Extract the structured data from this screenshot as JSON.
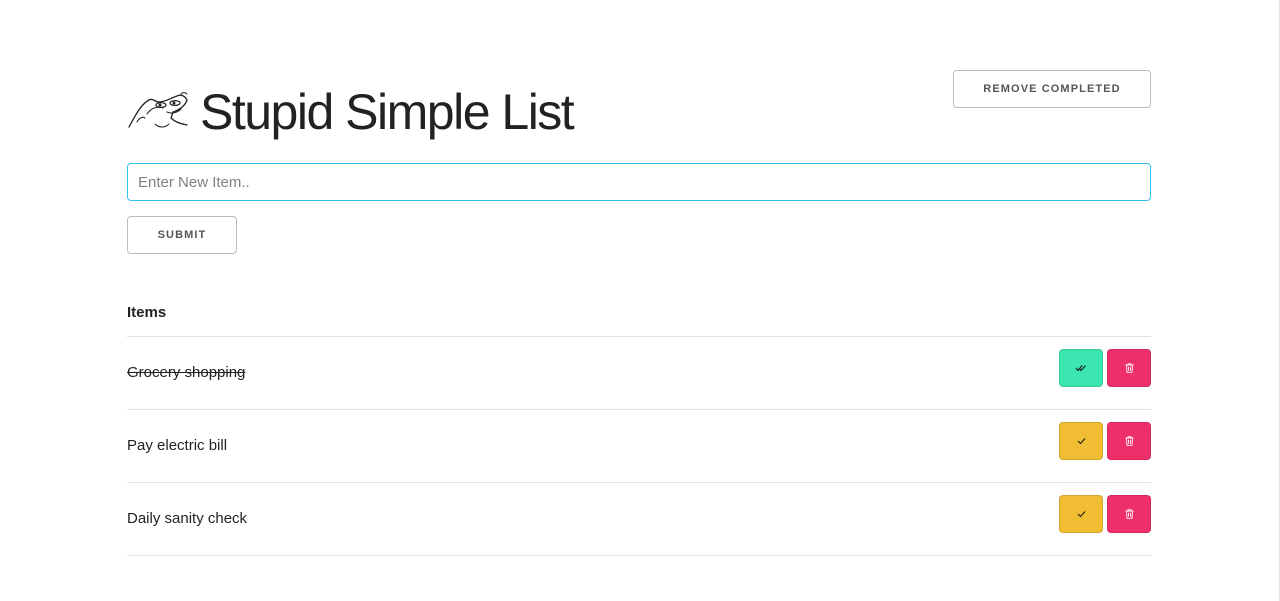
{
  "app": {
    "title": "Stupid Simple List",
    "logo_icon": "frog-face-icon"
  },
  "toolbar": {
    "remove_completed_label": "Remove Completed"
  },
  "form": {
    "placeholder": "Enter New Item..",
    "value": "",
    "submit_label": "Submit"
  },
  "list": {
    "header": "Items",
    "items": [
      {
        "label": "Grocery shopping",
        "completed": true
      },
      {
        "label": "Pay electric bill",
        "completed": false
      },
      {
        "label": "Daily sanity check",
        "completed": false
      }
    ]
  },
  "colors": {
    "accent_input_border": "#33c3f0",
    "complete_done": "#3de6b0",
    "complete_todo": "#f0bd33",
    "delete": "#ef2f6a"
  },
  "icons": {
    "done": "double-check-icon",
    "todo": "check-icon",
    "delete": "trash-icon"
  }
}
